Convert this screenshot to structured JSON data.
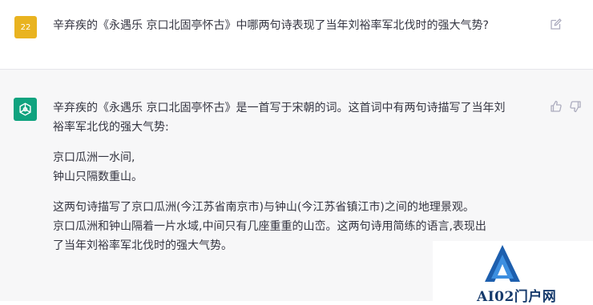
{
  "user_message": {
    "avatar_text": "22",
    "avatar_color": "#e9b320",
    "text": "辛弃疾的《永遇乐 京口北固亭怀古》中哪两句诗表现了当年刘裕率军北伐时的强大气势?",
    "edit_icon": "edit-icon"
  },
  "assistant_message": {
    "avatar_icon": "openai-logo-icon",
    "avatar_color": "#10a37f",
    "paragraphs": [
      {
        "line1": "辛弃疾的《永遇乐 京口北固亭怀古》是一首写于宋朝的词。这首词中有两句诗描写了当年刘",
        "line2": "裕率军北伐的强大气势:"
      },
      {
        "line1": "京口瓜洲一水间,",
        "line2": "钟山只隔数重山。"
      },
      {
        "line1": "这两句诗描写了京口瓜洲(今江苏省南京市)与钟山(今江苏省镇江市)之间的地理景观。",
        "line2": "京口瓜洲和钟山隔着一片水域,中间只有几座重重的山峦。这两句诗用简练的语言,表现出",
        "line3": "了当年刘裕率军北伐时的强大气势。"
      }
    ],
    "feedback_icons": [
      "thumbs-up-icon",
      "thumbs-down-icon"
    ]
  },
  "watermark": {
    "text": "AI02门户网",
    "color": "#15396b"
  }
}
